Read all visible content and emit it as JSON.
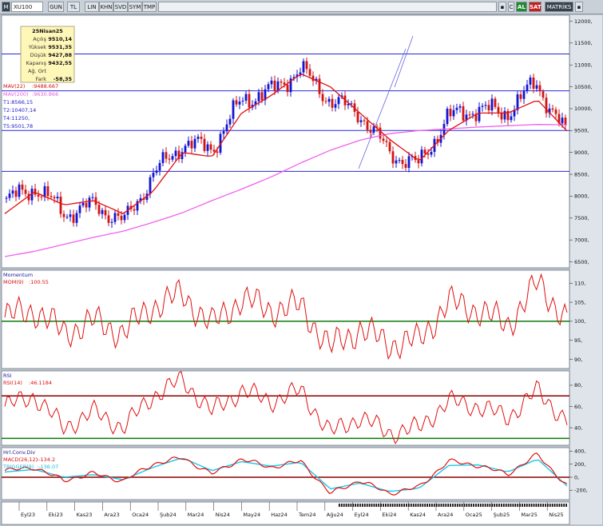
{
  "toolbar": {
    "menu_icon": "M",
    "symbol": "XU100",
    "period": "GUN",
    "currency": "TL",
    "scale_lin": "LIN",
    "khn": "KHN",
    "svd": "SVD",
    "sym": "SYM",
    "tmp": "TMP",
    "c_label": "C",
    "al_label": "AL",
    "sat_label": "SAT",
    "matriks_label": "MATRİKS"
  },
  "info_box": {
    "date": "25Nisan25",
    "rows": [
      {
        "label": "Açılış",
        "value": "9510,14"
      },
      {
        "label": "Yüksek",
        "value": "9531,35"
      },
      {
        "label": "Düşük",
        "value": "9427,88"
      },
      {
        "label": "Kapanış",
        "value": "9432,55"
      },
      {
        "label": "Ağ. Ort",
        "value": ""
      },
      {
        "label": "Fark",
        "value": "-58,35"
      }
    ]
  },
  "price_panel": {
    "mav22_label": "MAV(22)",
    "mav22_value": ":9488.667",
    "mav200_label": "MAV(200)",
    "mav200_value": ":9630.866",
    "t_labels": [
      "T1:8566,15",
      "T2:10407,14",
      "T4:11250,",
      "T5:9501,78"
    ],
    "y_ticks": [
      "12000,",
      "11500,",
      "11000,",
      "10500,",
      "10000,",
      "9500,",
      "9000,",
      "8500,",
      "8000,",
      "7500,",
      "7000,",
      "6500,"
    ],
    "colors": {
      "candle_up": "#1414d2",
      "candle_down": "#d21414",
      "mav22": "#e01010",
      "mav200": "#f060f0",
      "trend": "#2828d8"
    }
  },
  "momentum_panel": {
    "title": "Momentum",
    "label": "MOM(9)",
    "value": ":100.55",
    "y_ticks": [
      "110,",
      "105,",
      "100,",
      "95,",
      "90,"
    ],
    "colors": {
      "line": "#e01010",
      "ref": "#0a7a0a"
    }
  },
  "rsi_panel": {
    "title": "RSI",
    "label": "RSI(14)",
    "value": ":46.1184",
    "y_ticks": [
      "80,",
      "60,",
      "40,"
    ],
    "colors": {
      "line": "#e01010",
      "upper": "#8b0000",
      "lower": "#0a7a0a"
    }
  },
  "macd_panel": {
    "title": "Hrl.Conv.Div",
    "macd_label": "MACD(26,12)",
    "macd_value": ":-134.2",
    "trigger_label": "TRIGGER(9)",
    "trigger_value": ":-136.07",
    "y_ticks": [
      "400,",
      "200,",
      "0,",
      "-200,"
    ],
    "colors": {
      "macd": "#e01010",
      "trigger": "#18c8e8",
      "zero": "#8b0000"
    }
  },
  "x_axis": {
    "labels": [
      "Eyl23",
      "Eki23",
      "Kas23",
      "Ara23",
      "Oca24",
      "Şub24",
      "Mar24",
      "Nis24",
      "May24",
      "Haz24",
      "Tem24",
      "Ağu24",
      "Eyl24",
      "Eki24",
      "Kas24",
      "Ara24",
      "Oca25",
      "Şub25",
      "Mar25",
      "Nis25"
    ]
  },
  "chart_data": {
    "type": "line",
    "title": "XU100 daily",
    "x": [
      "Eyl23",
      "Eki23",
      "Kas23",
      "Ara23",
      "Oca24",
      "Şub24",
      "Mar24",
      "Nis24",
      "May24",
      "Haz24",
      "Tem24",
      "Ağu24",
      "Eyl24",
      "Eki24",
      "Kas24",
      "Ara24",
      "Oca25",
      "Şub25",
      "Mar25",
      "Nis25"
    ],
    "series": [
      {
        "name": "Kapanış",
        "values": [
          7900,
          8200,
          7600,
          7800,
          7400,
          8500,
          9200,
          9100,
          10200,
          10400,
          10900,
          10200,
          9900,
          9000,
          8700,
          9800,
          10000,
          9900,
          10600,
          9433
        ]
      },
      {
        "name": "MAV(22)",
        "values": [
          7600,
          8100,
          7800,
          7900,
          7600,
          8100,
          9000,
          8900,
          9900,
          10300,
          10800,
          10500,
          9900,
          9300,
          8800,
          9500,
          9900,
          9900,
          10200,
          9489
        ]
      },
      {
        "name": "MAV(200)",
        "values": [
          6620,
          6740,
          6900,
          7060,
          7200,
          7400,
          7620,
          7900,
          8160,
          8440,
          8760,
          9050,
          9280,
          9430,
          9500,
          9540,
          9580,
          9610,
          9640,
          9631
        ]
      }
    ],
    "ylim": [
      6400,
      12100
    ],
    "horizontal_levels": [
      11250,
      10407.14,
      9501.78,
      8566.15
    ],
    "mom_values": [
      101,
      103,
      97,
      100,
      97,
      104,
      107,
      99,
      106,
      103,
      104,
      93,
      98,
      94,
      95,
      105,
      103,
      99,
      110,
      100.55
    ],
    "rsi_values": [
      60,
      70,
      40,
      55,
      40,
      70,
      85,
      55,
      75,
      65,
      75,
      35,
      50,
      35,
      40,
      65,
      60,
      50,
      75,
      46.1184
    ],
    "rsi_levels": [
      70,
      30
    ],
    "macd_values": [
      100,
      150,
      -50,
      60,
      -60,
      200,
      300,
      50,
      280,
      150,
      250,
      -250,
      -50,
      -250,
      -150,
      250,
      180,
      50,
      350,
      -134.2
    ],
    "trigger_values": [
      80,
      120,
      0,
      40,
      -40,
      150,
      300,
      100,
      240,
      170,
      230,
      -180,
      -90,
      -220,
      -170,
      180,
      190,
      80,
      280,
      -136.07
    ]
  }
}
